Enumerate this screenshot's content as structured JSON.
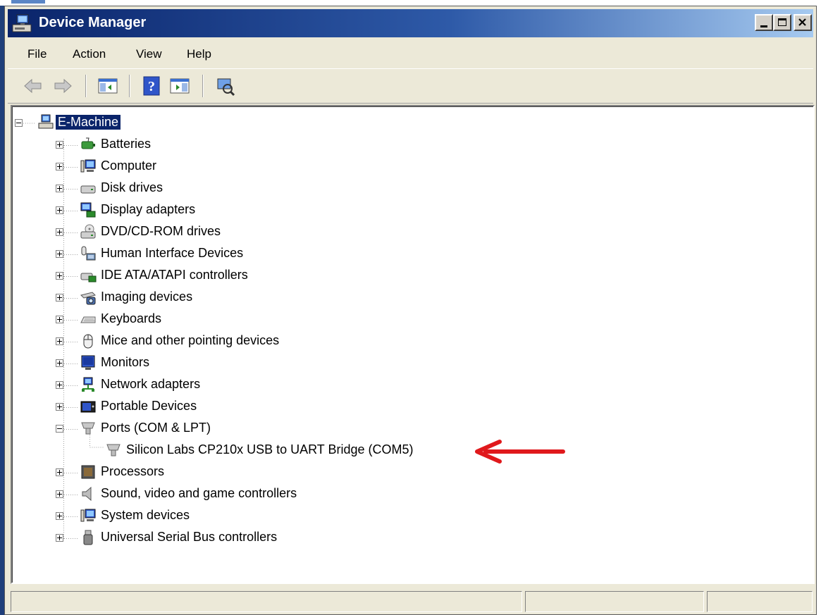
{
  "window": {
    "title": "Device Manager",
    "buttons": [
      "minimize-button",
      "maximize-button",
      "close-button"
    ]
  },
  "menu": [
    "File",
    "Action",
    "View",
    "Help"
  ],
  "toolbar": {
    "icons": [
      "back-icon",
      "forward-icon",
      "show-hide-console-tree-icon",
      "help-icon",
      "properties-icon",
      "scan-hardware-icon"
    ]
  },
  "tree": {
    "root": "E-Machine",
    "items": [
      {
        "label": "Batteries",
        "icon": "battery-icon",
        "expanded": false
      },
      {
        "label": "Computer",
        "icon": "computer-icon",
        "expanded": false
      },
      {
        "label": "Disk drives",
        "icon": "disk-drive-icon",
        "expanded": false
      },
      {
        "label": "Display adapters",
        "icon": "display-adapter-icon",
        "expanded": false
      },
      {
        "label": "DVD/CD-ROM drives",
        "icon": "dvd-drive-icon",
        "expanded": false
      },
      {
        "label": "Human Interface Devices",
        "icon": "hid-icon",
        "expanded": false
      },
      {
        "label": "IDE ATA/ATAPI controllers",
        "icon": "ide-controller-icon",
        "expanded": false
      },
      {
        "label": "Imaging devices",
        "icon": "imaging-icon",
        "expanded": false
      },
      {
        "label": "Keyboards",
        "icon": "keyboard-icon",
        "expanded": false
      },
      {
        "label": "Mice and other pointing devices",
        "icon": "mouse-icon",
        "expanded": false
      },
      {
        "label": "Monitors",
        "icon": "monitor-icon",
        "expanded": false
      },
      {
        "label": "Network adapters",
        "icon": "network-icon",
        "expanded": false
      },
      {
        "label": "Portable Devices",
        "icon": "portable-device-icon",
        "expanded": false
      },
      {
        "label": "Ports (COM & LPT)",
        "icon": "port-icon",
        "expanded": true,
        "children": [
          {
            "label": "Silicon Labs CP210x USB to UART Bridge (COM5)",
            "icon": "port-icon"
          }
        ]
      },
      {
        "label": "Processors",
        "icon": "processor-icon",
        "expanded": false
      },
      {
        "label": "Sound, video and game controllers",
        "icon": "speaker-icon",
        "expanded": false
      },
      {
        "label": "System devices",
        "icon": "system-device-icon",
        "expanded": false
      },
      {
        "label": "Universal Serial Bus controllers",
        "icon": "usb-icon",
        "expanded": false
      }
    ]
  },
  "annotation": {
    "arrow_color": "#e0191c"
  },
  "colors": {
    "title_start": "#0a246a",
    "title_end": "#a6caf0",
    "selection": "#0a246a",
    "chrome": "#ece9d8"
  }
}
